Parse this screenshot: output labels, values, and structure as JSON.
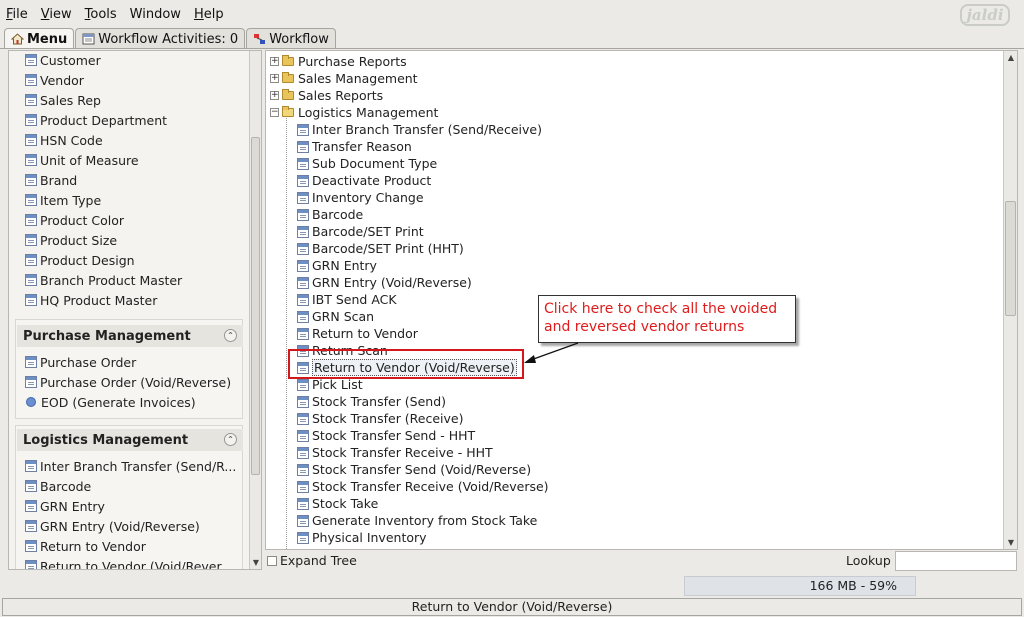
{
  "menubar": {
    "items": [
      {
        "label": "File",
        "key": "F",
        "rest": "ile"
      },
      {
        "label": "View",
        "key": "V",
        "rest": "iew"
      },
      {
        "label": "Tools",
        "key": "T",
        "rest": "ools"
      },
      {
        "label": "Window",
        "key": "",
        "rest": "Window"
      },
      {
        "label": "Help",
        "key": "H",
        "rest": "elp"
      }
    ],
    "logo": "jaldi"
  },
  "tabs": [
    {
      "label": "Menu"
    },
    {
      "label": "Workflow Activities: 0"
    },
    {
      "label": "Workflow"
    }
  ],
  "left_panel": {
    "top_items": [
      "Customer",
      "Vendor",
      "Sales Rep",
      "Product Department",
      "HSN Code",
      "Unit of Measure",
      "Brand",
      "Item Type",
      "Product Color",
      "Product Size",
      "Product Design",
      "Branch Product Master",
      "HQ Product Master"
    ],
    "purchase_group": {
      "title": "Purchase Management",
      "items": [
        "Purchase Order",
        "Purchase Order (Void/Reverse)",
        "EOD (Generate Invoices)"
      ]
    },
    "logistics_group": {
      "title": "Logistics Management",
      "items": [
        "Inter Branch Transfer (Send/R...",
        "Barcode",
        "GRN Entry",
        "GRN Entry (Void/Reverse)",
        "Return to Vendor",
        "Return to Vendor (Void/Rever..."
      ]
    }
  },
  "tree": {
    "folders": [
      "Purchase Reports",
      "Sales Management",
      "Sales Reports",
      "Logistics Management"
    ],
    "items": [
      "Inter Branch Transfer (Send/Receive)",
      "Transfer Reason",
      "Sub Document Type",
      "Deactivate Product",
      "Inventory Change",
      "Barcode",
      "Barcode/SET Print",
      "Barcode/SET Print (HHT)",
      "GRN Entry",
      "GRN Entry (Void/Reverse)",
      "IBT Send ACK",
      "GRN Scan",
      "Return to Vendor",
      "Return Scan",
      "Return to Vendor (Void/Reverse)",
      "Pick List",
      "Stock Transfer (Send)",
      "Stock Transfer (Receive)",
      "Stock Transfer Send - HHT",
      "Stock Transfer Receive - HHT",
      "Stock Transfer Send (Void/Reverse)",
      "Stock Transfer Receive (Void/Reverse)",
      "Stock Take",
      "Generate Inventory from Stock Take",
      "Physical Inventory"
    ],
    "selected": "Return to Vendor (Void/Reverse)"
  },
  "callout": {
    "line1": "Click here to check all the voided",
    "line2": "and reversed vendor returns",
    "color": "#e01b1b"
  },
  "bottom": {
    "expand_tree": "Expand Tree",
    "lookup": "Lookup",
    "memory": "166 MB - 59%",
    "status": "Return to Vendor (Void/Reverse)"
  },
  "colors": {
    "highlight_border": "#d4171b",
    "background": "#eceae6"
  }
}
